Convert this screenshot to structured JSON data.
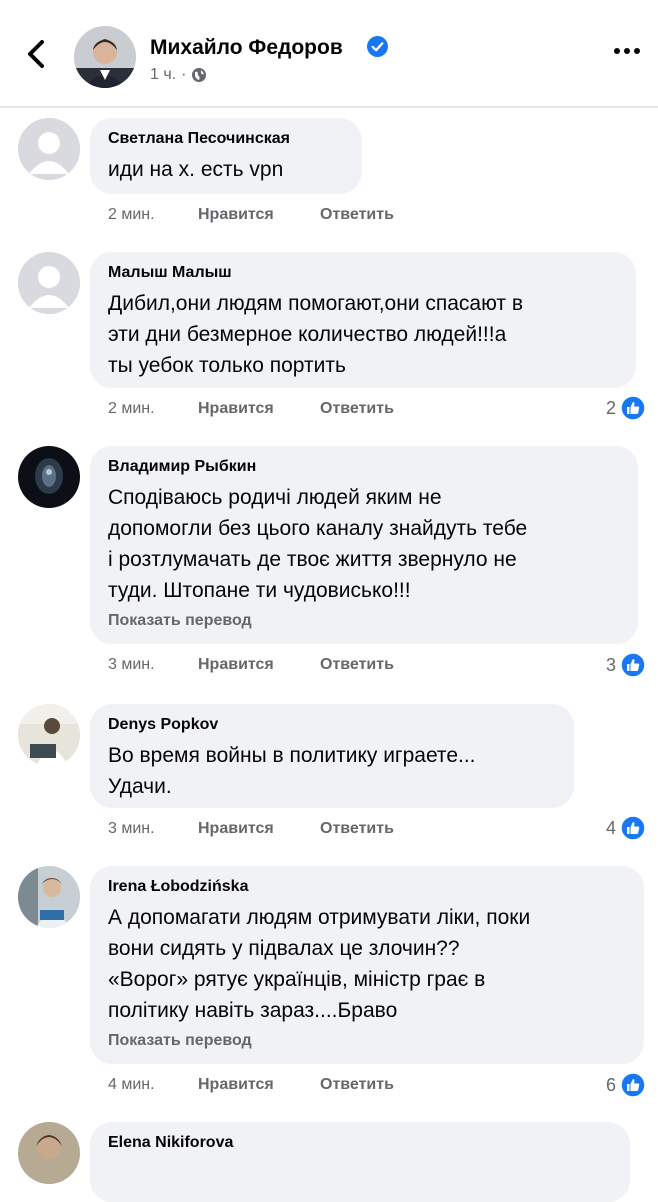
{
  "header": {
    "author": "Михайло Федоров",
    "time": "1 ч."
  },
  "comments": [
    {
      "name": "Светлана Песочинская",
      "text": "иди на х. есть vpn",
      "time": "2 мин.",
      "like": "Нравится",
      "reply": "Ответить",
      "likes": ""
    },
    {
      "name": "Малыш Малыш",
      "text": "Дибил,они людям помогают,они спасают в\nэти дни безмерное количество людей!!!а\nты уебок только портить",
      "time": "2 мин.",
      "like": "Нравится",
      "reply": "Ответить",
      "likes": "2"
    },
    {
      "name": "Владимир Рыбкин",
      "text": "Сподіваюсь родичі людей яким не\nдопомогли без цього каналу знайдуть тебе\nі розтлумачать де твоє життя звернуло не\nтуди. Штопане ти чудовисько!!!",
      "translate": "Показать перевод",
      "time": "3 мин.",
      "like": "Нравится",
      "reply": "Ответить",
      "likes": "3"
    },
    {
      "name": "Denys Popkov",
      "text": "Во время войны в политику играете...\nУдачи.",
      "time": "3 мин.",
      "like": "Нравится",
      "reply": "Ответить",
      "likes": "4"
    },
    {
      "name": "Irena Łobodzińska",
      "text": "А допомагати людям отримувати ліки, поки\nвони сидять у підвалах це злочин??\n«Ворог» рятує українців, міністр грає в\nполітику навіть зараз....Браво",
      "translate": "Показать перевод",
      "time": "4 мин.",
      "like": "Нравится",
      "reply": "Ответить",
      "likes": "6"
    },
    {
      "name": "Elena Nikiforova"
    }
  ],
  "colors": {
    "accent": "#1877f2",
    "bubble": "#f0f2f5",
    "secondary_text": "#65676b"
  }
}
